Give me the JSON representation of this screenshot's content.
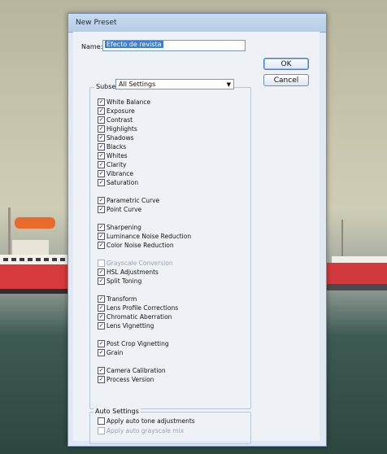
{
  "dialog": {
    "title": "New Preset",
    "name_label": "Name:",
    "name_value": "Efecto de revista",
    "ok_label": "OK",
    "cancel_label": "Cancel",
    "subset_label": "Subset:",
    "subset_value": "All Settings",
    "settings": [
      {
        "label": "White Balance",
        "checked": true,
        "enabled": true
      },
      {
        "label": "Exposure",
        "checked": true,
        "enabled": true
      },
      {
        "label": "Contrast",
        "checked": true,
        "enabled": true
      },
      {
        "label": "Highlights",
        "checked": true,
        "enabled": true
      },
      {
        "label": "Shadows",
        "checked": true,
        "enabled": true
      },
      {
        "label": "Blacks",
        "checked": true,
        "enabled": true
      },
      {
        "label": "Whites",
        "checked": true,
        "enabled": true
      },
      {
        "label": "Clarity",
        "checked": true,
        "enabled": true
      },
      {
        "label": "Vibrance",
        "checked": true,
        "enabled": true
      },
      {
        "label": "Saturation",
        "checked": true,
        "enabled": true
      },
      {
        "label": "Parametric Curve",
        "checked": true,
        "enabled": true
      },
      {
        "label": "Point Curve",
        "checked": true,
        "enabled": true
      },
      {
        "label": "Sharpening",
        "checked": true,
        "enabled": true
      },
      {
        "label": "Luminance Noise Reduction",
        "checked": true,
        "enabled": true
      },
      {
        "label": "Color Noise Reduction",
        "checked": true,
        "enabled": true
      },
      {
        "label": "Grayscale Conversion",
        "checked": false,
        "enabled": false
      },
      {
        "label": "HSL Adjustments",
        "checked": true,
        "enabled": true
      },
      {
        "label": "Split Toning",
        "checked": true,
        "enabled": true
      },
      {
        "label": "Transform",
        "checked": true,
        "enabled": true
      },
      {
        "label": "Lens Profile Corrections",
        "checked": true,
        "enabled": true
      },
      {
        "label": "Chromatic Aberration",
        "checked": true,
        "enabled": true
      },
      {
        "label": "Lens Vignetting",
        "checked": true,
        "enabled": true
      },
      {
        "label": "Post Crop Vignetting",
        "checked": true,
        "enabled": true
      },
      {
        "label": "Grain",
        "checked": true,
        "enabled": true
      },
      {
        "label": "Camera Calibration",
        "checked": true,
        "enabled": true
      },
      {
        "label": "Process Version",
        "checked": true,
        "enabled": true
      }
    ],
    "auto_settings_label": "Auto Settings",
    "auto_settings": [
      {
        "label": "Apply auto tone adjustments",
        "checked": false,
        "enabled": true
      },
      {
        "label": "Apply auto grayscale mix",
        "checked": false,
        "enabled": false
      }
    ]
  }
}
